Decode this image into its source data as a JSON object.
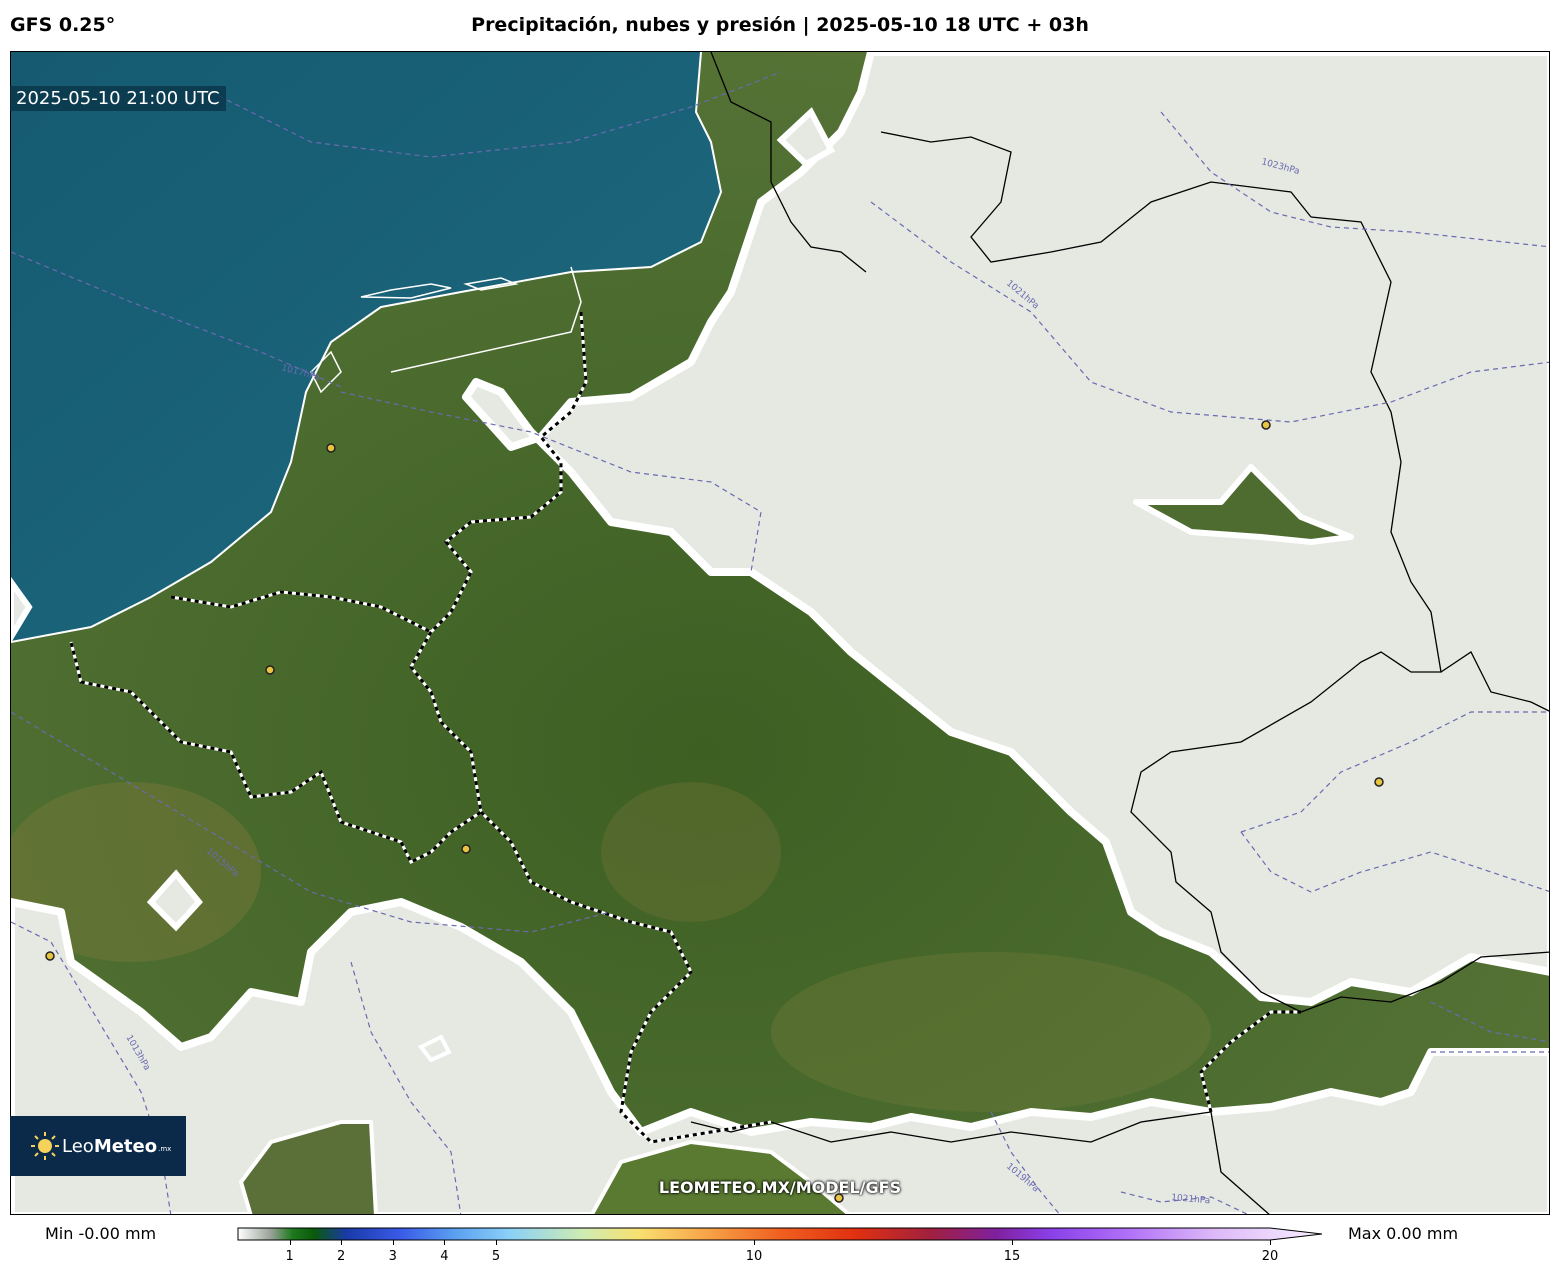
{
  "header": {
    "model": "GFS 0.25°",
    "title": "Precipitación, nubes y presión | 2025-05-10 18 UTC + 03h"
  },
  "map": {
    "timestamp": "2025-05-10 21:00 UTC",
    "isobar_labels": [
      "1023hPa",
      "1021hPa",
      "1017hPa",
      "1015hPa",
      "1013hPa",
      "1019hPa",
      "1021hPa"
    ],
    "watermark": "LEOMETEO.MX/MODEL/GFS",
    "colors": {
      "sea": "#1b5f78",
      "land": "#4a6a30",
      "cloud": "#e6e8e2",
      "isobar": "#6a6ab0",
      "city_marker": "#e8c440"
    }
  },
  "logo": {
    "name_light": "Leo",
    "name_bold": "Meteo",
    "suffix": ".mx"
  },
  "legend": {
    "min_label": "Min -0.00 mm",
    "max_label": "Max 0.00 mm",
    "ticks": [
      "1",
      "2",
      "3",
      "4",
      "5",
      "10",
      "15",
      "20"
    ],
    "tick_values": [
      1,
      2,
      3,
      4,
      5,
      10,
      15,
      20
    ],
    "range": [
      0,
      20
    ],
    "gradient": [
      [
        0,
        "#ffffff"
      ],
      [
        0.03,
        "#9aa39a"
      ],
      [
        0.05,
        "#1e7a1e"
      ],
      [
        0.07,
        "#0a5a0a"
      ],
      [
        0.1,
        "#1a3aa8"
      ],
      [
        0.15,
        "#3a5ae8"
      ],
      [
        0.2,
        "#5aa0f0"
      ],
      [
        0.25,
        "#8ad0f8"
      ],
      [
        0.32,
        "#d0ecb0"
      ],
      [
        0.37,
        "#f8e070"
      ],
      [
        0.42,
        "#f8b050"
      ],
      [
        0.5,
        "#f06020"
      ],
      [
        0.57,
        "#e03010"
      ],
      [
        0.64,
        "#a02040"
      ],
      [
        0.7,
        "#8020a0"
      ],
      [
        0.75,
        "#8a40e8"
      ],
      [
        0.82,
        "#b070f8"
      ],
      [
        0.9,
        "#dcb8f8"
      ],
      [
        1,
        "#f8f0ff"
      ]
    ]
  }
}
